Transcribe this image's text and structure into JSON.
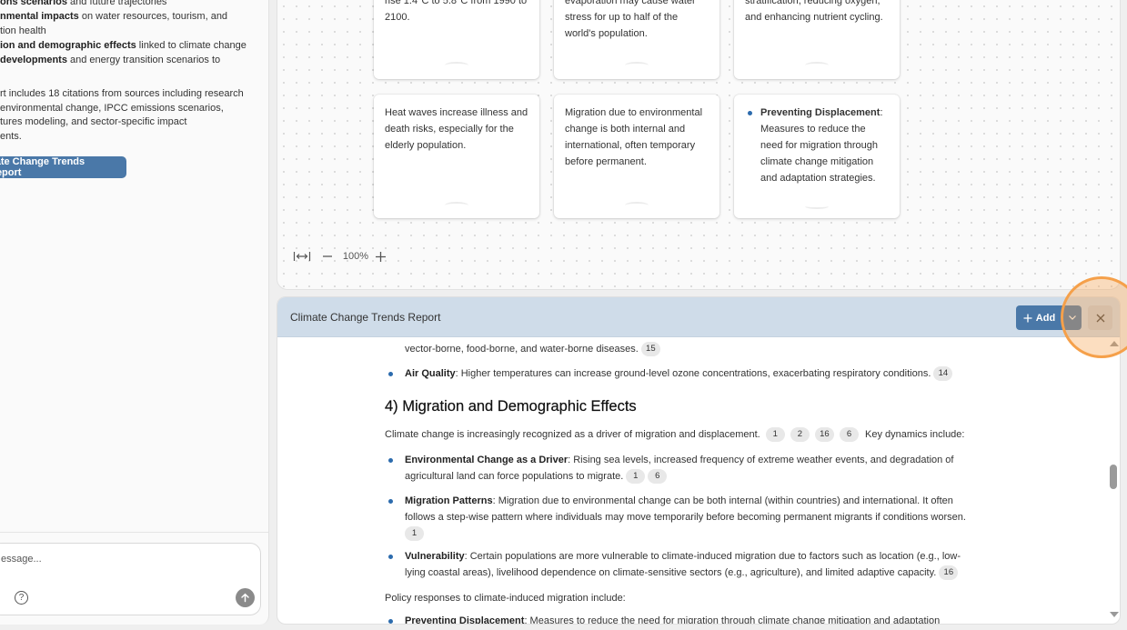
{
  "chat": {
    "lines": [
      {
        "bold": "ons scenarios",
        "rest": " and future trajectories"
      },
      {
        "bold": "nmental impacts",
        "rest": " on water resources, tourism, and"
      },
      {
        "bold": "",
        "rest": "tion health"
      },
      {
        "bold": "ion and demographic effects",
        "rest": " linked to climate change"
      },
      {
        "bold": "developments",
        "rest": " and energy transition scenarios to"
      }
    ],
    "paragraph": [
      "rt includes 18 citations from sources including research",
      "environmental change, IPCC emissions scenarios,",
      "tures modeling, and sector-specific impact",
      "ents."
    ],
    "report_chip": "nate Change Trends Report",
    "composer_placeholder": "essage..."
  },
  "canvas": {
    "nodes": [
      {
        "text": "rise 1.4°C to 5.8°C from 1990 to 2100."
      },
      {
        "text": "evaporation may cause water stress for up to half of the world's population."
      },
      {
        "text": "stratification, reducing oxygen, and enhancing nutrient cycling."
      },
      {
        "text": "Heat waves increase illness and death risks, especially for the elderly population."
      },
      {
        "text": "Migration due to environmental change is both internal and international, often temporary before permanent."
      },
      {
        "bold": "Preventing Displacement",
        "text": ": Measures to reduce the need for migration through climate change mitigation and adaptation strategies."
      }
    ],
    "zoom": {
      "level": "100%"
    }
  },
  "report": {
    "title": "Climate Change Trends Report",
    "add_label": "Add",
    "partial_line": "vector-borne, food-borne, and water-borne diseases.",
    "partial_cite": "15",
    "air_quality": {
      "bold": "Air Quality",
      "text": ": Higher temperatures can increase ground-level ozone concentrations, exacerbating respiratory conditions.",
      "cite": "14"
    },
    "section_heading": "4) Migration and Demographic Effects",
    "intro": {
      "text": "Climate change is increasingly recognized as a driver of migration and displacement.",
      "cites": [
        "1",
        "2",
        "16",
        "6"
      ],
      "after": "Key dynamics include:"
    },
    "bullets": [
      {
        "bold": "Environmental Change as a Driver",
        "line1": ": Rising sea levels, increased frequency of extreme weather events, and degradation of",
        "line2": "agricultural land can force populations to migrate.",
        "cites": [
          "1",
          "6"
        ]
      },
      {
        "bold": "Migration Patterns",
        "line1": ": Migration due to environmental change can be both internal (within countries) and international. It often",
        "line2": "follows a step-wise pattern where individuals may move temporarily before becoming permanent migrants if conditions worsen.",
        "cites": [
          "1"
        ]
      },
      {
        "bold": "Vulnerability",
        "line1": ": Certain populations are more vulnerable to climate-induced migration due to factors such as location (e.g., low-",
        "line2": "lying coastal areas), livelihood dependence on climate-sensitive sectors (e.g., agriculture), and limited adaptive capacity.",
        "cites": [
          "16"
        ]
      }
    ],
    "policy_intro": "Policy responses to climate-induced migration include:",
    "last_bullet": {
      "bold": "Preventing Displacement",
      "text": ": Measures to reduce the need for migration through climate change mitigation and adaptation"
    }
  }
}
